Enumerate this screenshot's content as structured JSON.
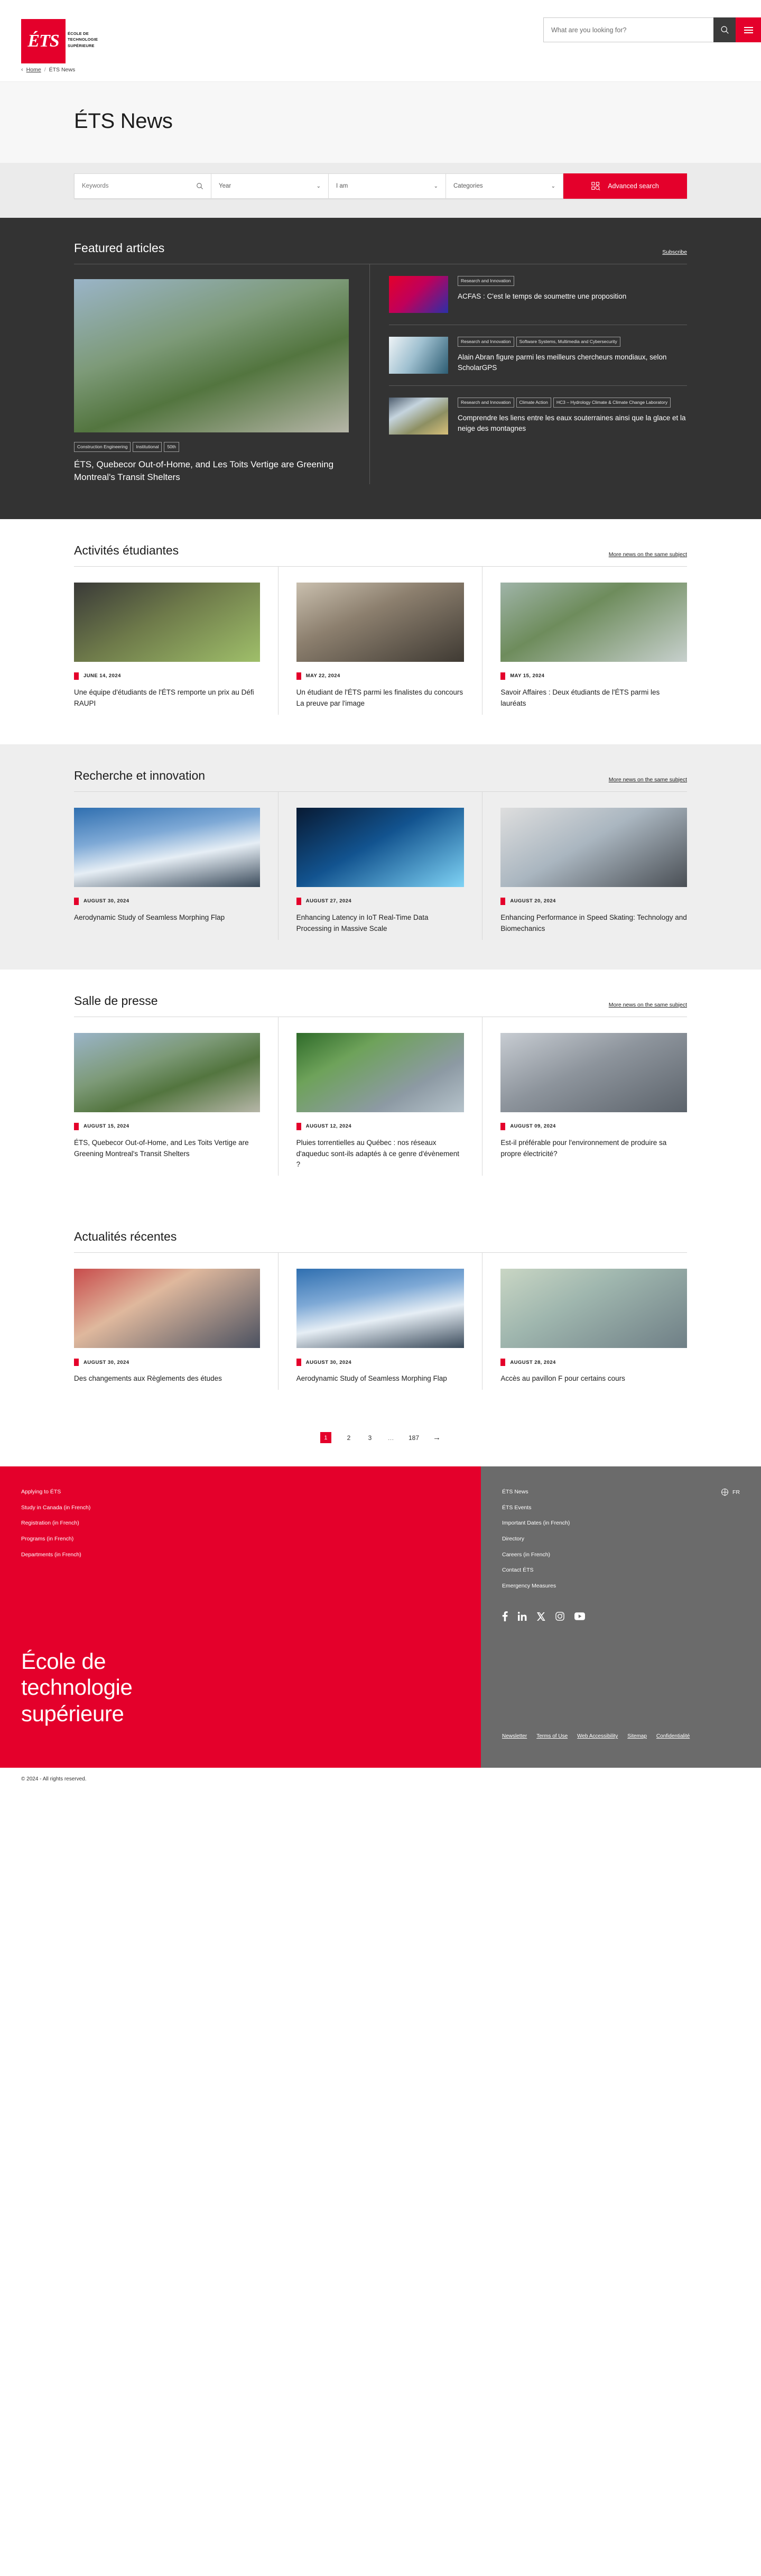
{
  "header": {
    "logo_text": "ÉTS",
    "logo_words": [
      "École de",
      "Technologie",
      "Supérieure"
    ],
    "search_placeholder": "What are you looking for?",
    "search_value": "",
    "search_icon": "search-icon",
    "menu_icon": "hamburger-menu-icon"
  },
  "breadcrumb": {
    "back_chevron": "‹",
    "home": "Home",
    "separator": "/",
    "current": "ÉTS News"
  },
  "page": {
    "title": "ÉTS News"
  },
  "filters": {
    "keywords_placeholder": "Keywords",
    "keywords_value": "",
    "search_icon": "search-icon",
    "year_label": "Year",
    "i_am_label": "I am",
    "categories_label": "Categories",
    "chevron": "⌄",
    "advanced_label": "Advanced search",
    "advanced_icon": "advanced-search-icon"
  },
  "featured": {
    "title": "Featured articles",
    "subscribe_label": "Subscribe",
    "main": {
      "tags": [
        "Construction Engineering",
        "Institutional",
        "50th"
      ],
      "title": "ÉTS, Quebecor Out-of-Home, and Les Toits Vertige are Greening Montreal's Transit Shelters",
      "image_class": "img-a"
    },
    "side": [
      {
        "tags": [
          "Research and Innovation"
        ],
        "title": "ACFAS : C'est le temps de soumettre une proposition",
        "image_class": "img-b"
      },
      {
        "tags": [
          "Research and Innovation",
          "Software Systems, Multimedia and Cybersecurity"
        ],
        "title": "Alain Abran figure parmi les meilleurs chercheurs mondiaux, selon ScholarGPS",
        "image_class": "img-c"
      },
      {
        "tags": [
          "Research and Innovation",
          "Climate Action",
          "HC3 – Hydrology Climate & Climate Change Laboratory"
        ],
        "title": "Comprendre les liens entre les eaux souterraines ainsi que la glace et la neige des montagnes",
        "image_class": "img-d"
      }
    ]
  },
  "sections": [
    {
      "id": "activites-etudiantes",
      "title": "Activités étudiantes",
      "link_label": "More news on the same subject",
      "theme": "white",
      "cards": [
        {
          "date": "JUNE 14, 2024",
          "title": "Une équipe d'étudiants de l'ÉTS remporte un prix au Défi RAUPI",
          "image_class": "img-e"
        },
        {
          "date": "MAY 22, 2024",
          "title": "Un étudiant de l'ÉTS parmi les finalistes du concours La preuve par l'image",
          "image_class": "img-f"
        },
        {
          "date": "MAY 15, 2024",
          "title": "Savoir Affaires : Deux étudiants de l'ÉTS parmi les lauréats",
          "image_class": "img-g"
        }
      ]
    },
    {
      "id": "recherche-et-innovation",
      "title": "Recherche et innovation",
      "link_label": "More news on the same subject",
      "theme": "grey",
      "cards": [
        {
          "date": "AUGUST 30, 2024",
          "title": "Aerodynamic Study of Seamless Morphing Flap",
          "image_class": "img-h"
        },
        {
          "date": "AUGUST 27, 2024",
          "title": "Enhancing Latency in IoT Real-Time Data Processing in Massive Scale",
          "image_class": "img-i"
        },
        {
          "date": "AUGUST 20, 2024",
          "title": "Enhancing Performance in Speed Skating: Technology and Biomechanics",
          "image_class": "img-j"
        }
      ]
    },
    {
      "id": "salle-de-presse",
      "title": "Salle de presse",
      "link_label": "More news on the same subject",
      "theme": "white",
      "cards": [
        {
          "date": "AUGUST 15, 2024",
          "title": "ÉTS, Quebecor Out-of-Home, and Les Toits Vertige are Greening Montreal's Transit Shelters",
          "image_class": "img-a"
        },
        {
          "date": "AUGUST 12, 2024",
          "title": "Pluies torrentielles au Québec : nos réseaux d'aqueduc sont-ils adaptés à ce genre d'évènement ?",
          "image_class": "img-k"
        },
        {
          "date": "AUGUST 09, 2024",
          "title": "Est-il préférable pour l'environnement de produire sa propre électricité?",
          "image_class": "img-l"
        }
      ]
    },
    {
      "id": "actualites-recentes",
      "title": "Actualités récentes",
      "link_label": "",
      "theme": "white",
      "cards": [
        {
          "date": "AUGUST 30, 2024",
          "title": "Des changements aux Règlements des études",
          "image_class": "img-m"
        },
        {
          "date": "AUGUST 30, 2024",
          "title": "Aerodynamic Study of Seamless Morphing Flap",
          "image_class": "img-h"
        },
        {
          "date": "AUGUST 28, 2024",
          "title": "Accès au pavillon F pour certains cours",
          "image_class": "img-n"
        }
      ]
    }
  ],
  "pagination": {
    "pages": [
      "1",
      "2",
      "3",
      "…",
      "187"
    ],
    "active": "1",
    "next_icon": "→"
  },
  "footer": {
    "red_links": [
      "Applying to ÉTS",
      "Study in Canada (in French)",
      "Registration (in French)",
      "Programs (in French)",
      "Departments (in French)"
    ],
    "grey_links": [
      "ÉTS News",
      "ÉTS Events",
      "Important Dates (in French)",
      "Directory",
      "Careers (in French)",
      "Contact ÉTS",
      "Emergency Measures"
    ],
    "language": {
      "icon": "globe-icon",
      "label": "FR"
    },
    "social": [
      "facebook-icon",
      "linkedin-icon",
      "x-twitter-icon",
      "instagram-icon",
      "youtube-icon"
    ],
    "wordmark": [
      "École de",
      "technologie",
      "supérieure"
    ],
    "legal_links": [
      "Newsletter",
      "Terms of Use",
      "Web Accessibility",
      "Sitemap",
      "Confidentialité"
    ],
    "copyright": "© 2024 - All rights reserved."
  },
  "colors": {
    "brand_red": "#e4002b",
    "dark": "#333333",
    "grey": "#6b6b6b"
  }
}
